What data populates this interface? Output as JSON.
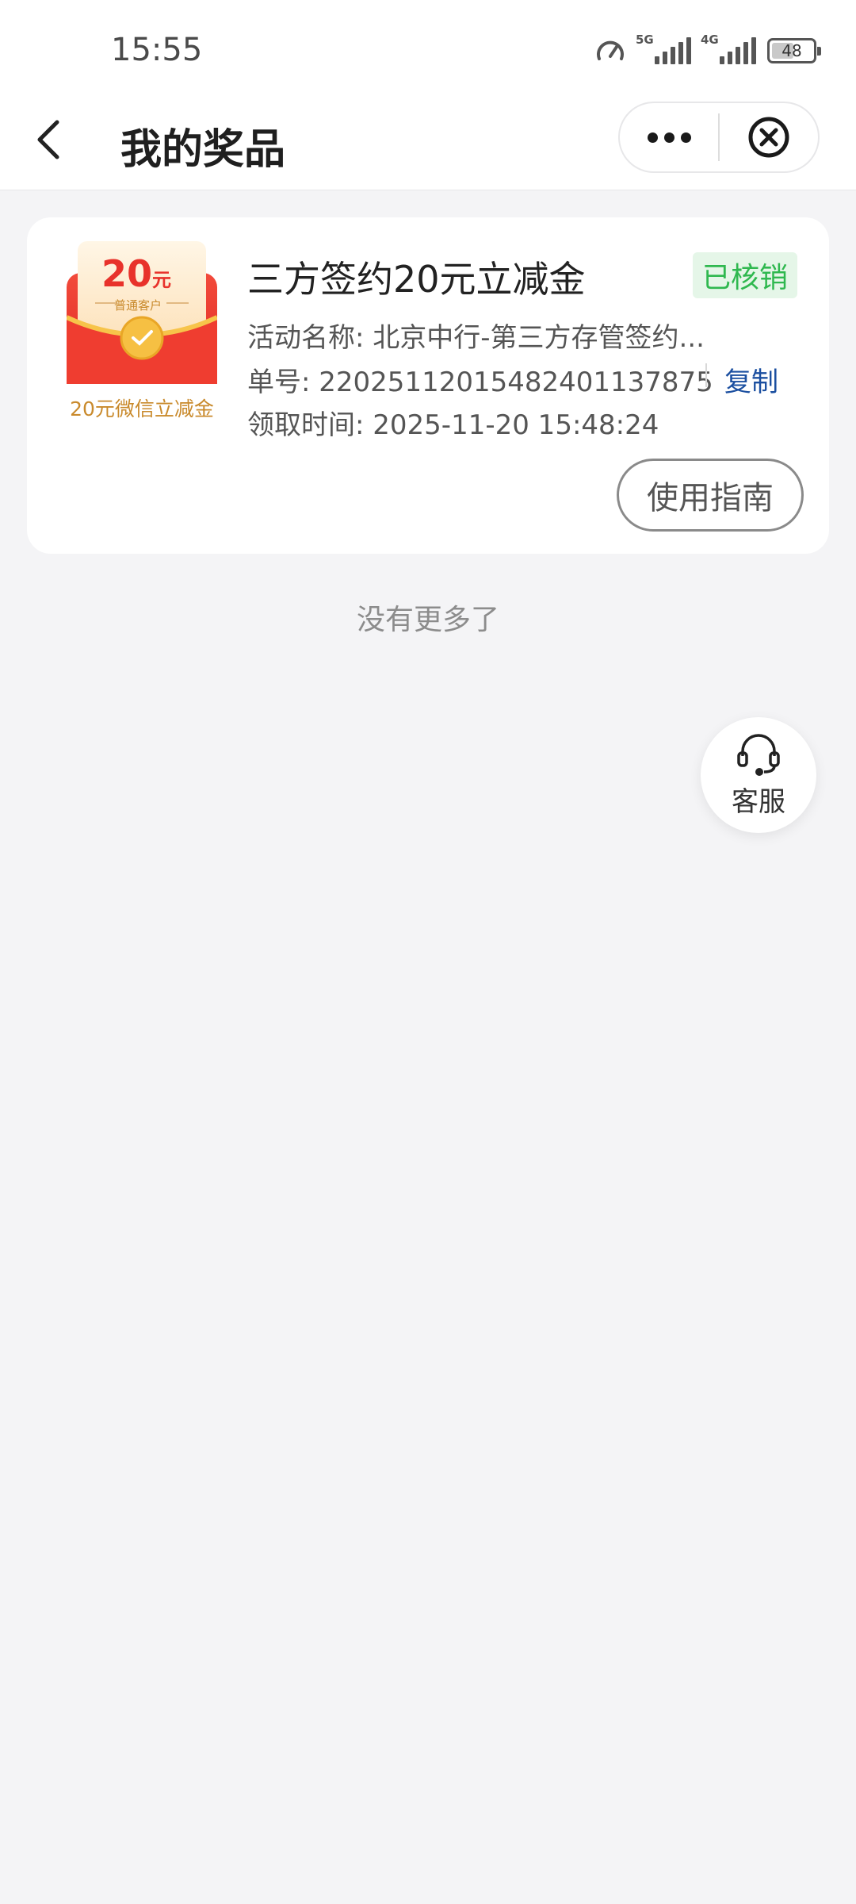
{
  "status_bar": {
    "time": "15:55",
    "network_1": "5G",
    "network_2": "4G",
    "battery": "48"
  },
  "navbar": {
    "title": "我的奖品",
    "icons": [
      "back-icon",
      "more-icon",
      "close-icon"
    ]
  },
  "prize": {
    "envelope": {
      "amount": "20",
      "unit": "元",
      "tier": "普通客户",
      "caption": "20元微信立减金"
    },
    "title": "三方签约20元立减金",
    "status": "已核销",
    "activity_label": "活动名称:",
    "activity_value": "北京中行-第三方存管签约...",
    "order_label": "单号:",
    "order_value": "220251120154824011 37875",
    "order_value_exact": "22025112015482401137875",
    "copy_label": "复制",
    "time_label": "领取时间:",
    "time_value": "2025-11-20 15:48:24",
    "guide_label": "使用指南"
  },
  "list_end": "没有更多了",
  "customer_service": {
    "label": "客服",
    "icon": "headset-icon"
  },
  "colors": {
    "status_green": "#2fb84f",
    "link_blue": "#1b4fa0",
    "envelope_red": "#e8322b",
    "gold": "#c98a2c"
  }
}
